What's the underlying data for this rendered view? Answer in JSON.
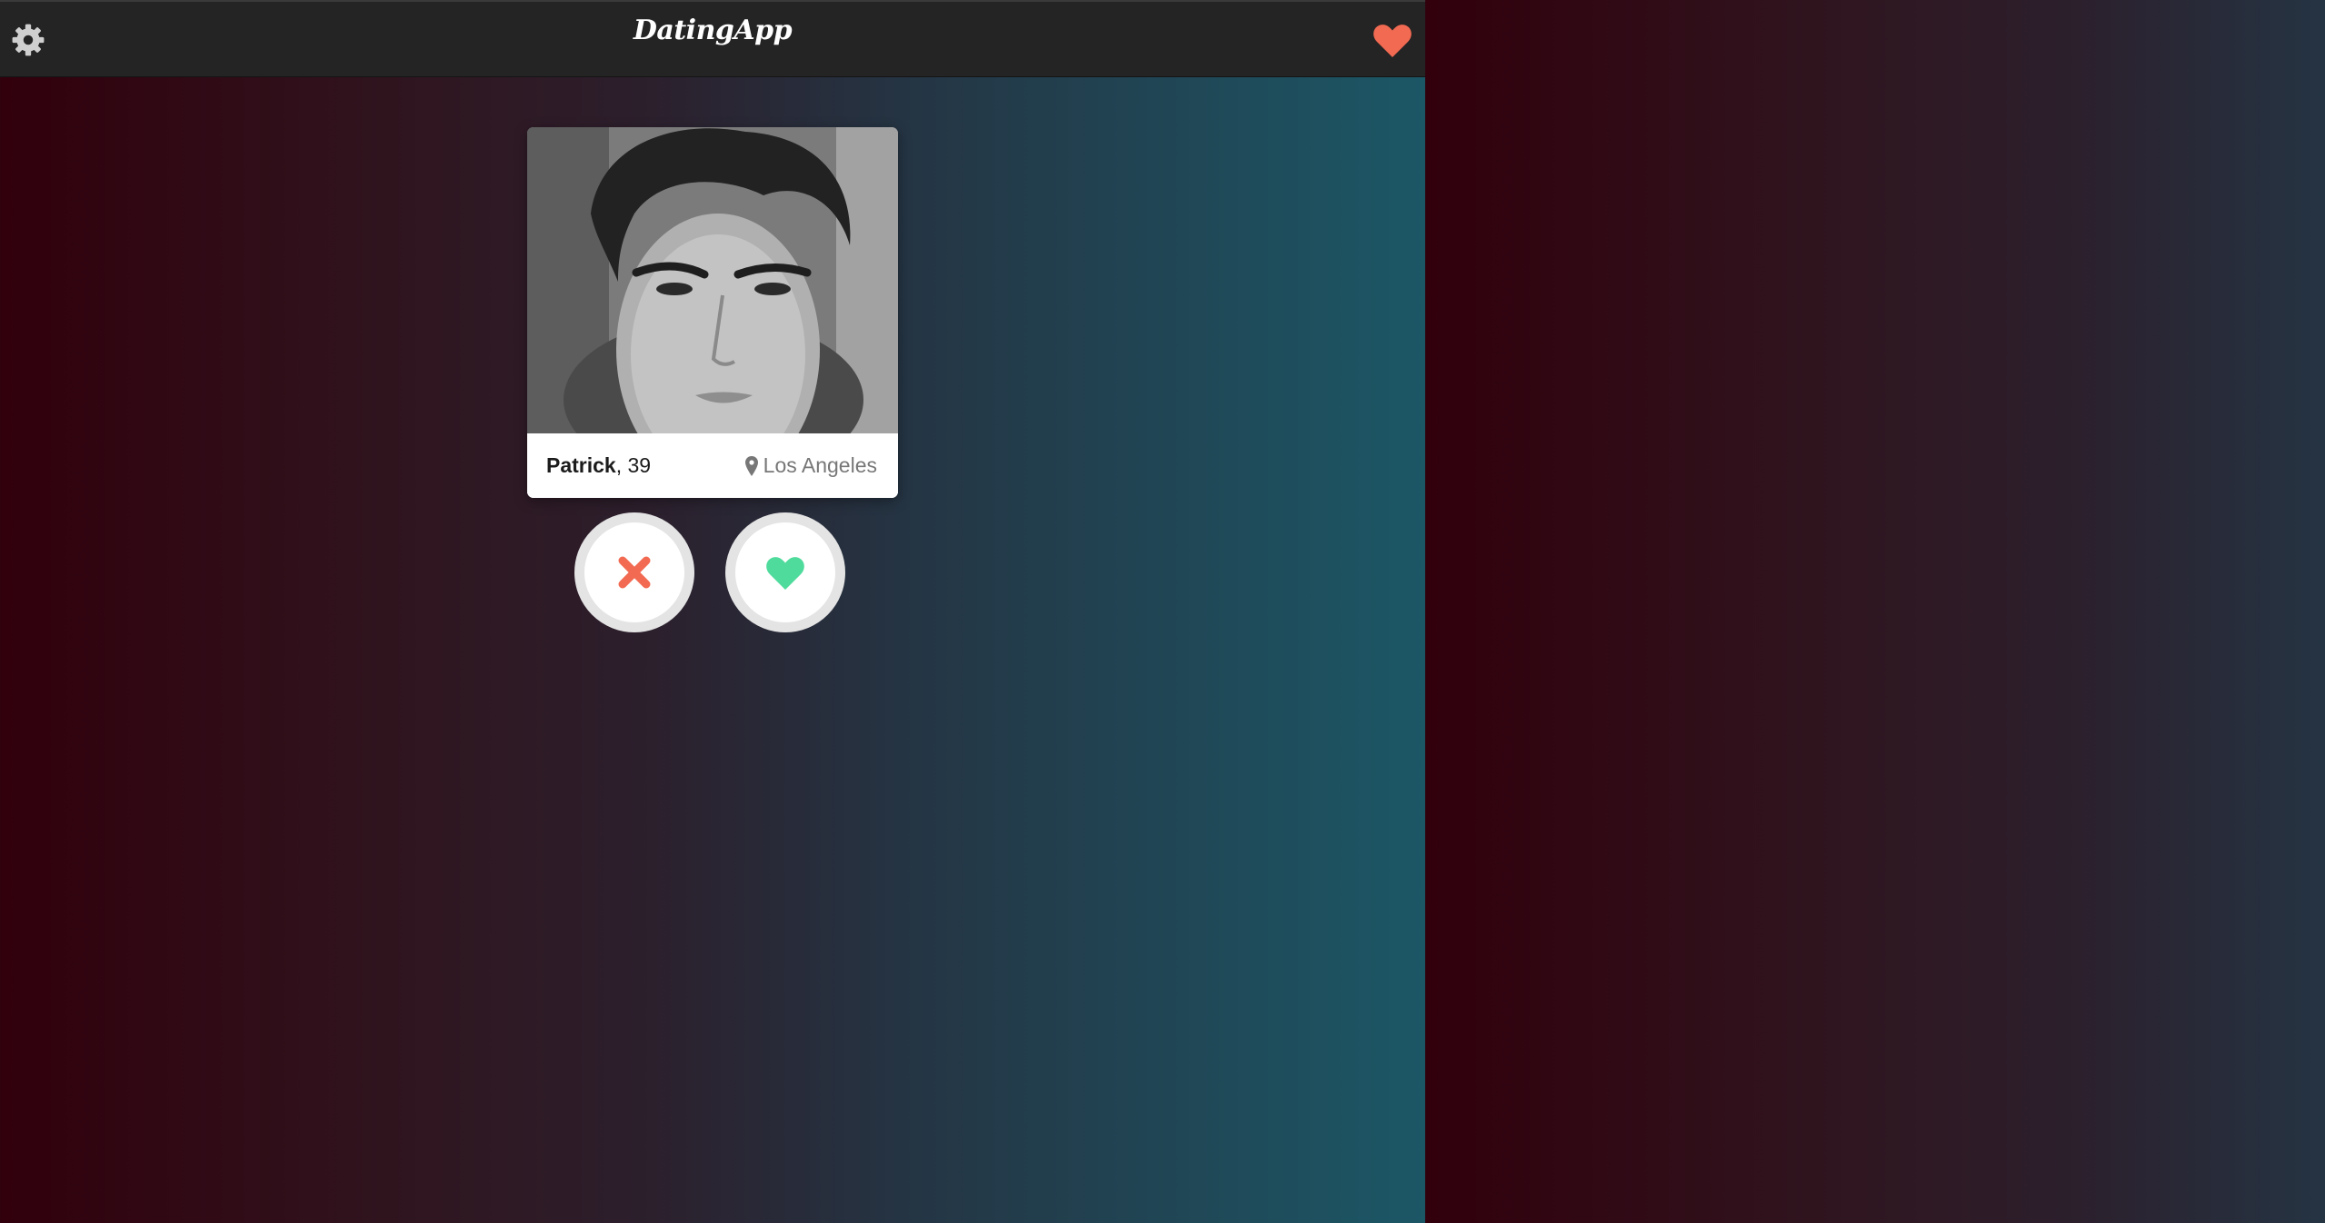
{
  "header": {
    "brand": "DatingApp",
    "settings_icon": "gear-icon",
    "matches_icon": "heart-icon",
    "accent_color": "#f26a52"
  },
  "profile": {
    "name": "Patrick",
    "age_text": ", 39",
    "location": "Los Angeles",
    "location_icon": "map-pin-icon",
    "photo": "black-and-white portrait photo"
  },
  "actions": {
    "dislike_icon": "x-icon",
    "dislike_color": "#f26a52",
    "like_icon": "heart-icon",
    "like_color": "#4fdb9c"
  }
}
